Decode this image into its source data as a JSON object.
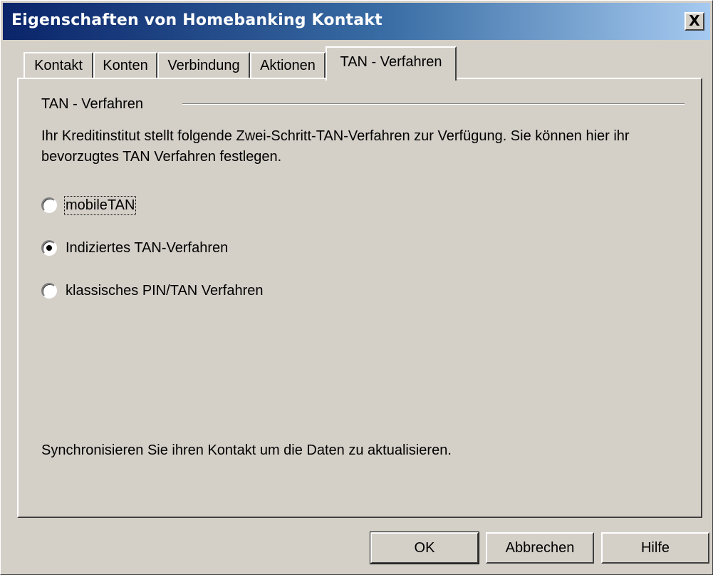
{
  "window": {
    "title": "Eigenschaften von Homebanking Kontakt",
    "close_symbol": "X"
  },
  "tabs": [
    {
      "label": "Kontakt",
      "active": false
    },
    {
      "label": "Konten",
      "active": false
    },
    {
      "label": "Verbindung",
      "active": false
    },
    {
      "label": "Aktionen",
      "active": false
    },
    {
      "label": "TAN - Verfahren",
      "active": true
    }
  ],
  "panel": {
    "group_title": "TAN - Verfahren",
    "description": "Ihr Kreditinstitut stellt folgende Zwei-Schritt-TAN-Verfahren zur Verfügung. Sie können hier ihr bevorzugtes TAN Verfahren festlegen.",
    "options": [
      {
        "label": "mobileTAN",
        "selected": false
      },
      {
        "label": "Indiziertes TAN-Verfahren",
        "selected": true
      },
      {
        "label": "klassisches PIN/TAN Verfahren",
        "selected": false
      }
    ],
    "footnote": "Synchronisieren Sie ihren Kontakt um die Daten zu aktualisieren."
  },
  "buttons": {
    "ok": "OK",
    "cancel": "Abbrechen",
    "help": "Hilfe"
  },
  "icons": {
    "close": "close-icon"
  },
  "colors": {
    "titlebar_start": "#0a246a",
    "titlebar_end": "#a6caf0",
    "face": "#d4d0c8"
  }
}
